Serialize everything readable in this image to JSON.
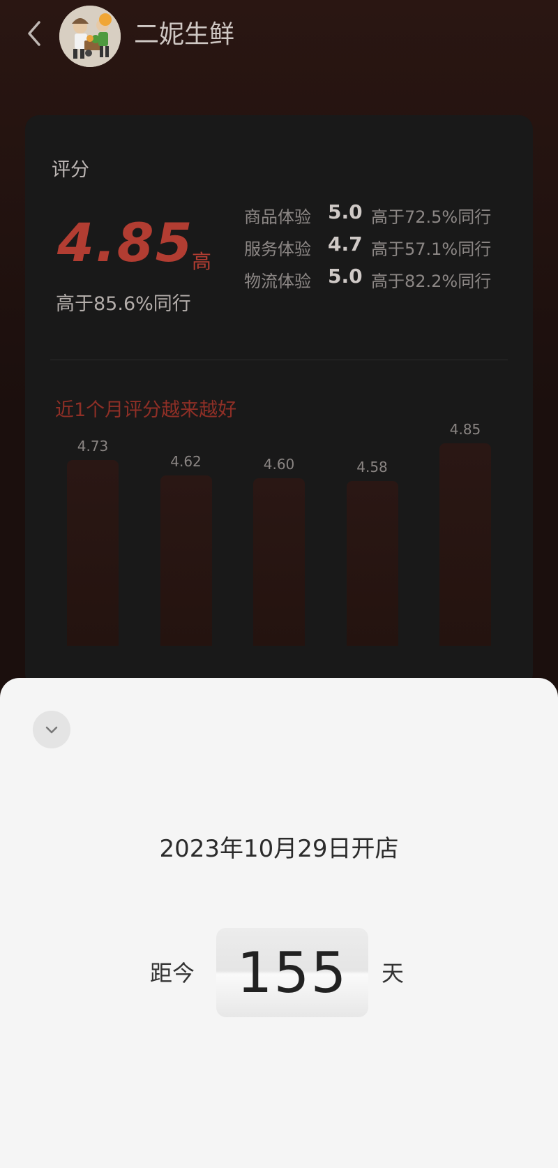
{
  "header": {
    "shop_name": "二妮生鲜"
  },
  "rating": {
    "title": "评分",
    "score": "4.85",
    "level": "高",
    "compare": "高于85.6%同行",
    "metrics": [
      {
        "label": "商品体验",
        "score": "5.0",
        "compare": "高于72.5%同行"
      },
      {
        "label": "服务体验",
        "score": "4.7",
        "compare": "高于57.1%同行"
      },
      {
        "label": "物流体验",
        "score": "5.0",
        "compare": "高于82.2%同行"
      }
    ]
  },
  "trend": {
    "title": "近1个月评分越来越好"
  },
  "chart_data": {
    "type": "bar",
    "categories": [
      "",
      "",
      "",
      "",
      ""
    ],
    "values": [
      4.73,
      4.62,
      4.6,
      4.58,
      4.85
    ],
    "value_labels": [
      "4.73",
      "4.62",
      "4.60",
      "4.58",
      "4.85"
    ]
  },
  "sheet": {
    "open_date": "2023年10月29日开店",
    "since_label": "距今",
    "days": "155",
    "days_unit": "天"
  },
  "colors": {
    "accent": "#b23d32",
    "sheet_bg": "#f5f5f5",
    "card_bg": "#191919"
  },
  "icons": {
    "back": "chevron-left-icon",
    "collapse": "chevron-down-icon"
  }
}
